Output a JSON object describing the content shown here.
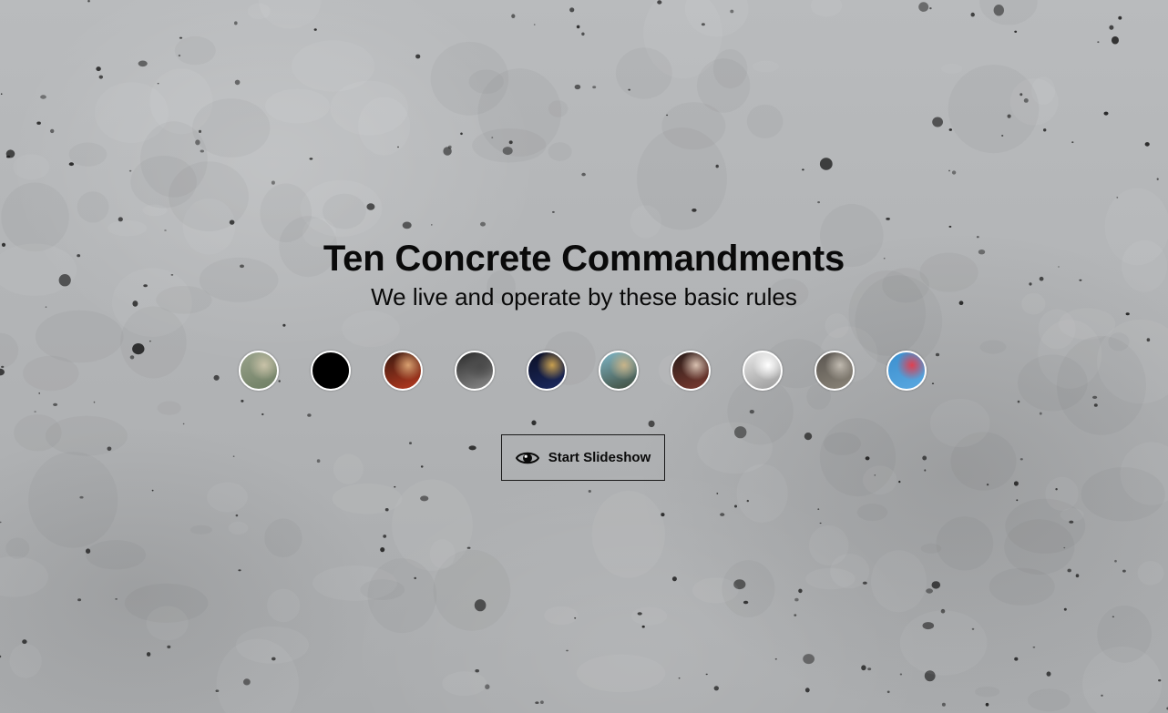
{
  "hero": {
    "title": "Ten Concrete Commandments",
    "subtitle": "We live and operate by these basic rules"
  },
  "slides": [
    {
      "label": "slide-1",
      "colors": [
        "#9aa38c",
        "#6e7e63",
        "#c9c2a8"
      ]
    },
    {
      "label": "slide-2",
      "colors": [
        "#000000",
        "#000000",
        "#000000"
      ]
    },
    {
      "label": "slide-3",
      "colors": [
        "#3a1a10",
        "#b83a20",
        "#d8a070"
      ]
    },
    {
      "label": "slide-4",
      "colors": [
        "#2a2a2a",
        "#8a8a8a",
        "#4a4a4a"
      ]
    },
    {
      "label": "slide-5",
      "colors": [
        "#0b0f25",
        "#1c2a60",
        "#c8a050"
      ]
    },
    {
      "label": "slide-6",
      "colors": [
        "#7fb6c7",
        "#3e4a3a",
        "#c8b48a"
      ]
    },
    {
      "label": "slide-7",
      "colors": [
        "#2a1d1a",
        "#7a3a30",
        "#d8c0b0"
      ]
    },
    {
      "label": "slide-8",
      "colors": [
        "#e8e8e8",
        "#9a9a9a",
        "#ffffff"
      ]
    },
    {
      "label": "slide-9",
      "colors": [
        "#5a5550",
        "#8a8478",
        "#c0bab0"
      ]
    },
    {
      "label": "slide-10",
      "colors": [
        "#3b8fcf",
        "#5aa8e0",
        "#e04050"
      ]
    }
  ],
  "slideshow_button": {
    "label": "Start Slideshow",
    "icon": "eye-icon"
  }
}
